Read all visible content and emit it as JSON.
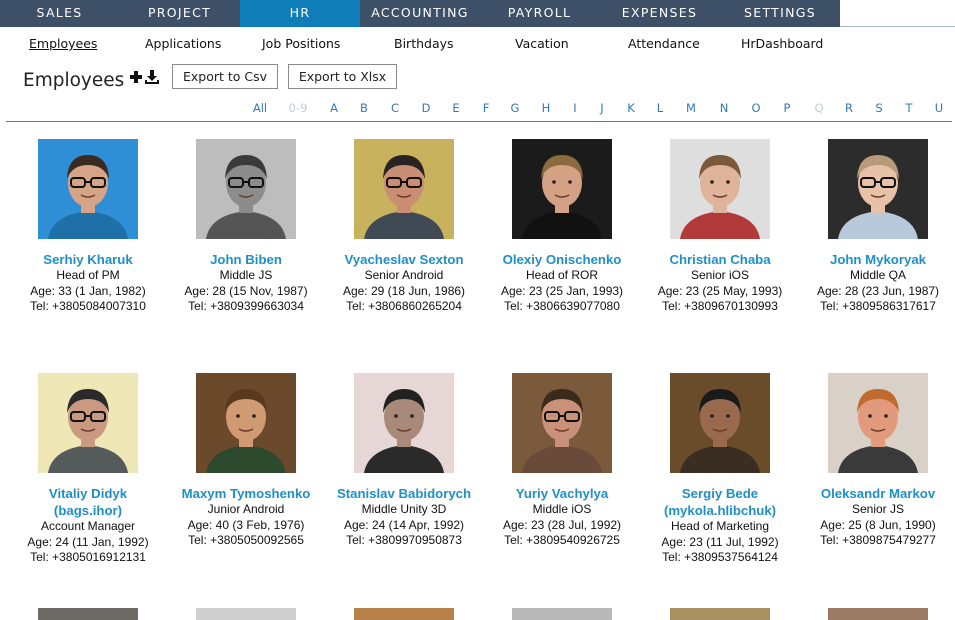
{
  "topnav": {
    "items": [
      {
        "label": "SALES"
      },
      {
        "label": "PROJECT"
      },
      {
        "label": "HR"
      },
      {
        "label": "ACCOUNTING"
      },
      {
        "label": "PAYROLL"
      },
      {
        "label": "EXPENSES"
      },
      {
        "label": "SETTINGS"
      }
    ],
    "active": "HR"
  },
  "subnav": {
    "items": [
      {
        "label": "Employees"
      },
      {
        "label": "Applications"
      },
      {
        "label": "Job Positions"
      },
      {
        "label": "Birthdays"
      },
      {
        "label": "Vacation"
      },
      {
        "label": "Attendance"
      },
      {
        "label": "HrDashboard"
      }
    ],
    "active": "Employees"
  },
  "page": {
    "title": "Employees",
    "add_icon": "plus-icon",
    "download_icon": "download-icon",
    "export_csv": "Export to Csv",
    "export_xlsx": "Export to Xlsx"
  },
  "alphabet": {
    "letters": [
      "All",
      "0-9",
      "A",
      "B",
      "C",
      "D",
      "E",
      "F",
      "G",
      "H",
      "I",
      "J",
      "K",
      "L",
      "M",
      "N",
      "O",
      "P",
      "Q",
      "R",
      "S",
      "T",
      "U"
    ],
    "disabled": [
      "0-9",
      "Q"
    ]
  },
  "colors": {
    "nav_bg": "#3d5068",
    "nav_active": "#0e7db8",
    "name_link": "#1e8fc8",
    "alpha_link": "#2f7ab8"
  },
  "employees": [
    {
      "name": "Serhiy Kharuk",
      "position": "Head of PM",
      "age": "Age: 33 (1 Jan, 1982)",
      "tel": "Tel: +3805084007310"
    },
    {
      "name": "John Biben",
      "position": "Middle JS",
      "age": "Age: 28 (15 Nov, 1987)",
      "tel": "Tel: +3809399663034"
    },
    {
      "name": "Vyacheslav Sexton",
      "position": "Senior Android",
      "age": "Age: 29 (18 Jun, 1986)",
      "tel": "Tel: +3806860265204"
    },
    {
      "name": "Olexiy Onischenko",
      "position": "Head of ROR",
      "age": "Age: 23 (25 Jan, 1993)",
      "tel": "Tel: +3806639077080"
    },
    {
      "name": "Christian Chaba",
      "position": "Senior iOS",
      "age": "Age: 23 (25 May, 1993)",
      "tel": "Tel: +3809670130993"
    },
    {
      "name": "John Mykoryak",
      "position": "Middle QA",
      "age": "Age: 28 (23 Jun, 1987)",
      "tel": "Tel: +3809586317617"
    },
    {
      "name": "Vitaliy Didyk",
      "name2": "(bags.ihor)",
      "position": "Account Manager",
      "age": "Age: 24 (11 Jan, 1992)",
      "tel": "Tel: +3805016912131"
    },
    {
      "name": "Maxym Tymoshenko",
      "position": "Junior Android",
      "age": "Age: 40 (3 Feb, 1976)",
      "tel": "Tel: +3805050092565"
    },
    {
      "name": "Stanislav Babidorych",
      "position": "Middle Unity 3D",
      "age": "Age: 24 (14 Apr, 1992)",
      "tel": "Tel: +3809970950873"
    },
    {
      "name": "Yuriy Vachylya",
      "position": "Middle iOS",
      "age": "Age: 23 (28 Jul, 1992)",
      "tel": "Tel: +3809540926725"
    },
    {
      "name": "Sergiy Bede",
      "name2": "(mykola.hlibchuk)",
      "position": "Head of Marketing",
      "age": "Age: 23 (11 Jul, 1992)",
      "tel": "Tel: +3809537564124"
    },
    {
      "name": "Oleksandr Markov",
      "position": "Senior JS",
      "age": "Age: 25 (8 Jun, 1990)",
      "tel": "Tel: +3809875479277"
    }
  ]
}
